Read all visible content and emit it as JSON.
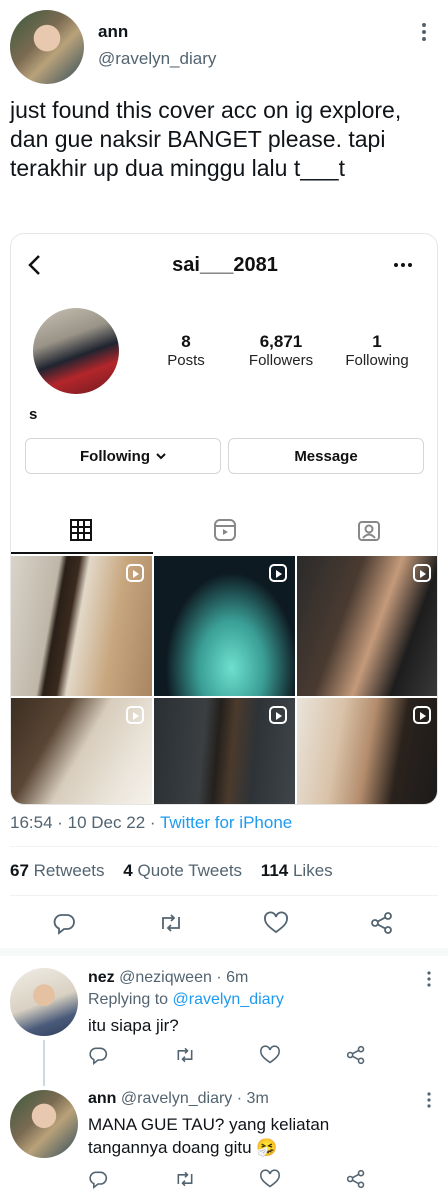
{
  "tweet": {
    "author_name": "ann",
    "author_handle": "@ravelyn_diary",
    "text": "just found this cover acc on ig explore, dan gue naksir BANGET please. tapi terakhir up dua minggu lalu t___t",
    "timestamp": "16:54 · 10 Dec 22 · ",
    "source": "Twitter for iPhone",
    "retweets_count": "67",
    "retweets_label": "Retweets",
    "quote_count": "4",
    "quote_label": "Quote Tweets",
    "likes_count": "114",
    "likes_label": "Likes"
  },
  "ig_screenshot": {
    "username": "sai___2081",
    "posts_count": "8",
    "posts_label": "Posts",
    "followers_count": "6,871",
    "followers_label": "Followers",
    "following_count": "1",
    "following_label": "Following",
    "bio": "s",
    "following_button": "Following",
    "message_button": "Message"
  },
  "replies": [
    {
      "name": "nez",
      "handle": "@neziqween",
      "time": "· 6m",
      "replying_prefix": "Replying to ",
      "replying_to": "@ravelyn_diary",
      "text": "itu siapa jir?"
    },
    {
      "name": "ann",
      "handle": "@ravelyn_diary",
      "time": "· 3m",
      "text": "MANA GUE TAU? yang keliatan tangannya doang gitu 🤧"
    }
  ],
  "icons": {
    "reply": "reply-icon",
    "retweet": "retweet-icon",
    "like": "heart-icon",
    "share": "share-icon",
    "more": "more-icon"
  },
  "colors": {
    "link": "#1d9bf0",
    "muted": "#536471",
    "text": "#0f1419"
  }
}
